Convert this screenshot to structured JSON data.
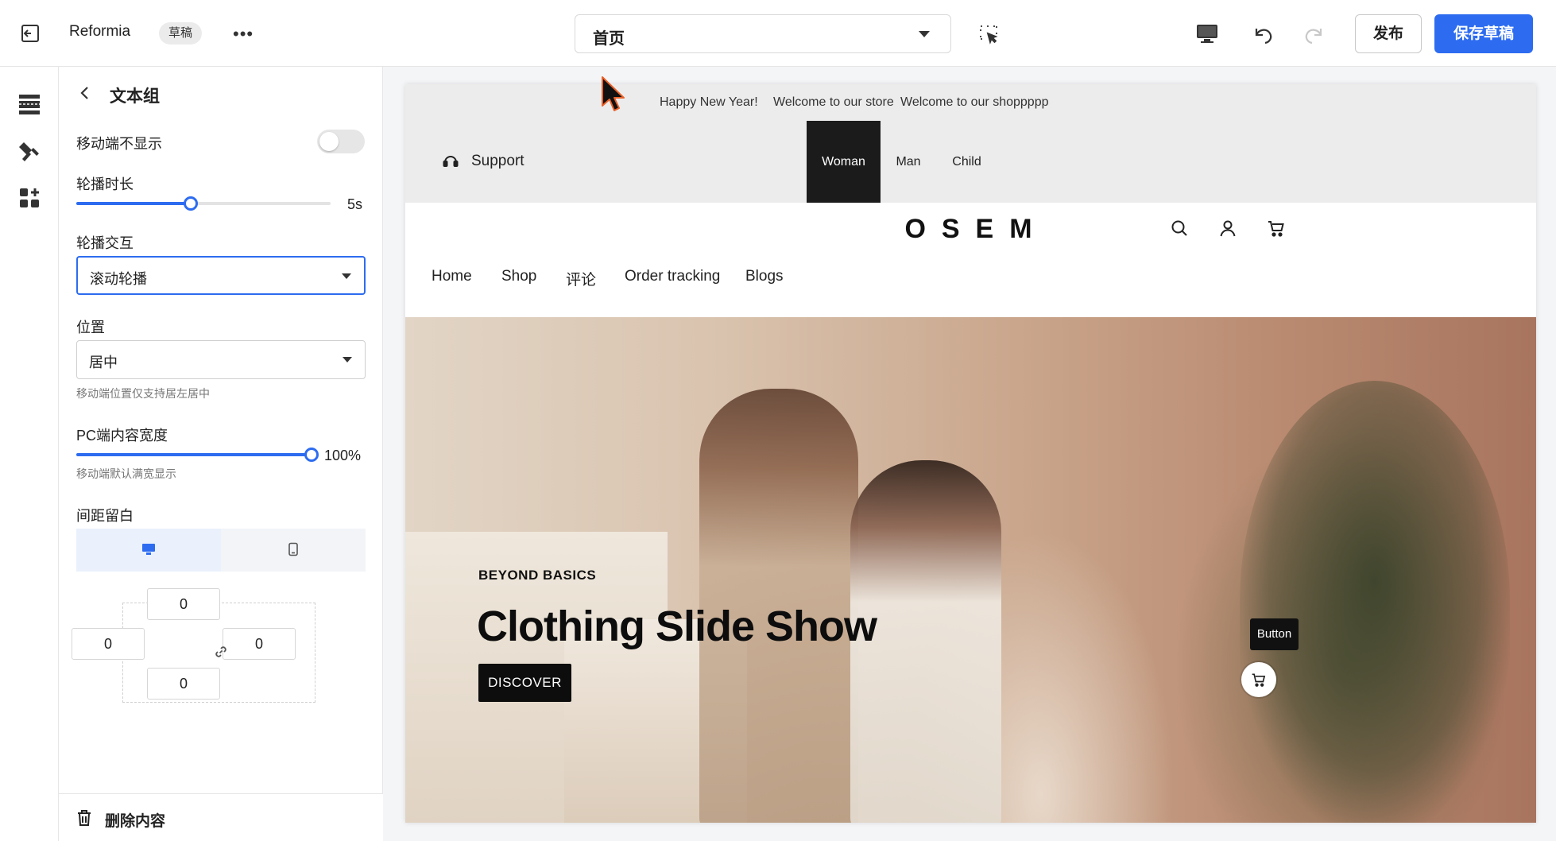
{
  "topbar": {
    "brand": "Reformia",
    "draft_badge": "草稿",
    "more": "•••",
    "page_selector": "首页",
    "publish_label": "发布",
    "save_draft_label": "保存草稿"
  },
  "panel": {
    "title": "文本组",
    "hide_on_mobile_label": "移动端不显示",
    "hide_on_mobile_on": false,
    "carousel_duration_label": "轮播时长",
    "carousel_duration_value": "5s",
    "carousel_duration_fraction": 0.45,
    "carousel_interaction_label": "轮播交互",
    "carousel_interaction_value": "滚动轮播",
    "position_label": "位置",
    "position_value": "居中",
    "position_hint": "移动端位置仅支持居左居中",
    "pc_width_label": "PC端内容宽度",
    "pc_width_value": "100%",
    "pc_width_fraction": 1.0,
    "pc_width_hint": "移动端默认满宽显示",
    "spacing_label": "间距留白",
    "spacing": {
      "top": "0",
      "left": "0",
      "right": "0",
      "bottom": "0"
    },
    "delete_label": "删除内容"
  },
  "site": {
    "announcements": [
      "Happy New Year!",
      "Welcome to our store",
      "Welcome to our shoppppp"
    ],
    "support_label": "Support",
    "gender_tabs": [
      {
        "label": "Woman",
        "active": true
      },
      {
        "label": "Man",
        "active": false
      },
      {
        "label": "Child",
        "active": false
      }
    ],
    "logo": "OSEM",
    "menu": [
      "Home",
      "Shop",
      "评论",
      "Order tracking",
      "Blogs"
    ],
    "hero": {
      "kicker": "BEYOND BASICS",
      "title": "Clothing Slide Show",
      "cta": "DISCOVER",
      "floating_button": "Button"
    }
  },
  "colors": {
    "accent": "#2d6cf0",
    "active_tab_bg": "#1b1b1b",
    "announce_bg": "#ececec"
  }
}
